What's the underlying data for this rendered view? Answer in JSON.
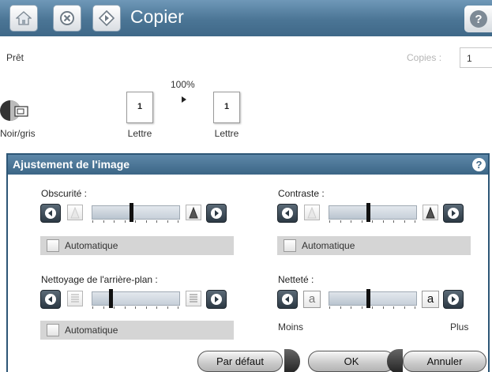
{
  "header": {
    "title": "Copier",
    "home_icon": "home-icon",
    "stop_icon": "stop-icon",
    "start_icon": "start-icon",
    "help_icon": "help-icon"
  },
  "status": {
    "ready": "Prêt",
    "copies_label": "Copies :",
    "copies_value": "1"
  },
  "preview": {
    "zoom": "100%",
    "original_count": "1",
    "original_paper": "Lettre",
    "output_count": "1",
    "output_paper": "Lettre",
    "color_mode": "Noir/gris"
  },
  "dialog": {
    "title": "Ajustement de l'image",
    "help": "?",
    "darkness": {
      "label": "Obscurité :",
      "level": 0.45,
      "auto_label": "Automatique"
    },
    "contrast": {
      "label": "Contraste :",
      "level": 0.45,
      "auto_label": "Automatique"
    },
    "background": {
      "label": "Nettoyage de l'arrière-plan :",
      "level": 0.2,
      "auto_label": "Automatique"
    },
    "sharpness": {
      "label": "Netteté :",
      "level": 0.45,
      "glyph": "a",
      "min_label": "Moins",
      "max_label": "Plus"
    },
    "buttons": {
      "default_label": "Par défaut",
      "ok_label": "OK",
      "cancel_label": "Annuler"
    }
  },
  "colors": {
    "title_bar": "#4b7595",
    "dialog_header": "#3c6686",
    "nav_button": "#2c3944"
  }
}
